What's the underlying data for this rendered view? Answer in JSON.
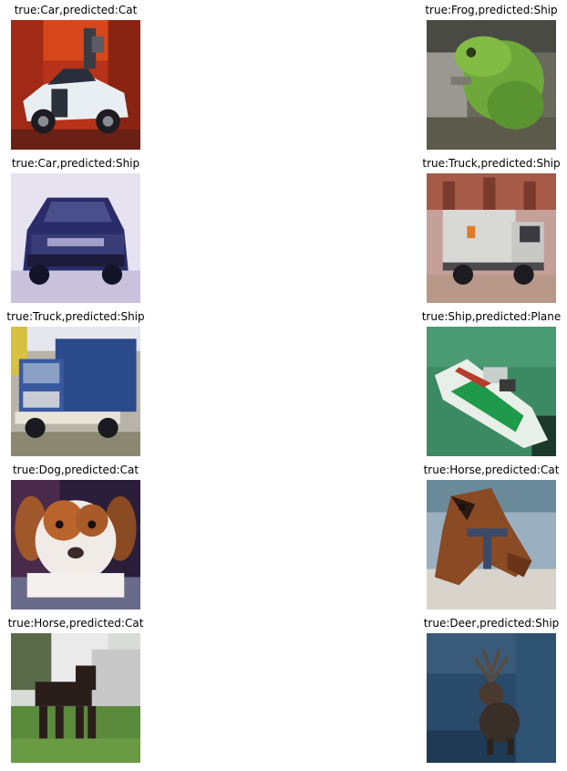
{
  "panels": [
    {
      "title": "true:Car,predicted:Cat",
      "subject": "white car on red background"
    },
    {
      "title": "true:Frog,predicted:Ship",
      "subject": "green frog on a ledge"
    },
    {
      "title": "true:Car,predicted:Ship",
      "subject": "dark blue SUV on pale background"
    },
    {
      "title": "true:Truck,predicted:Ship",
      "subject": "white box truck near a building"
    },
    {
      "title": "true:Truck,predicted:Ship",
      "subject": "blue dump truck"
    },
    {
      "title": "true:Ship,predicted:Plane",
      "subject": "white and green boat on the water"
    },
    {
      "title": "true:Dog,predicted:Cat",
      "subject": "brown and white puppy"
    },
    {
      "title": "true:Horse,predicted:Cat",
      "subject": "brown horse head with halter"
    },
    {
      "title": "true:Horse,predicted:Cat",
      "subject": "dark horse standing on grass"
    },
    {
      "title": "true:Deer,predicted:Ship",
      "subject": "deer with antlers in dark blue scene"
    }
  ]
}
